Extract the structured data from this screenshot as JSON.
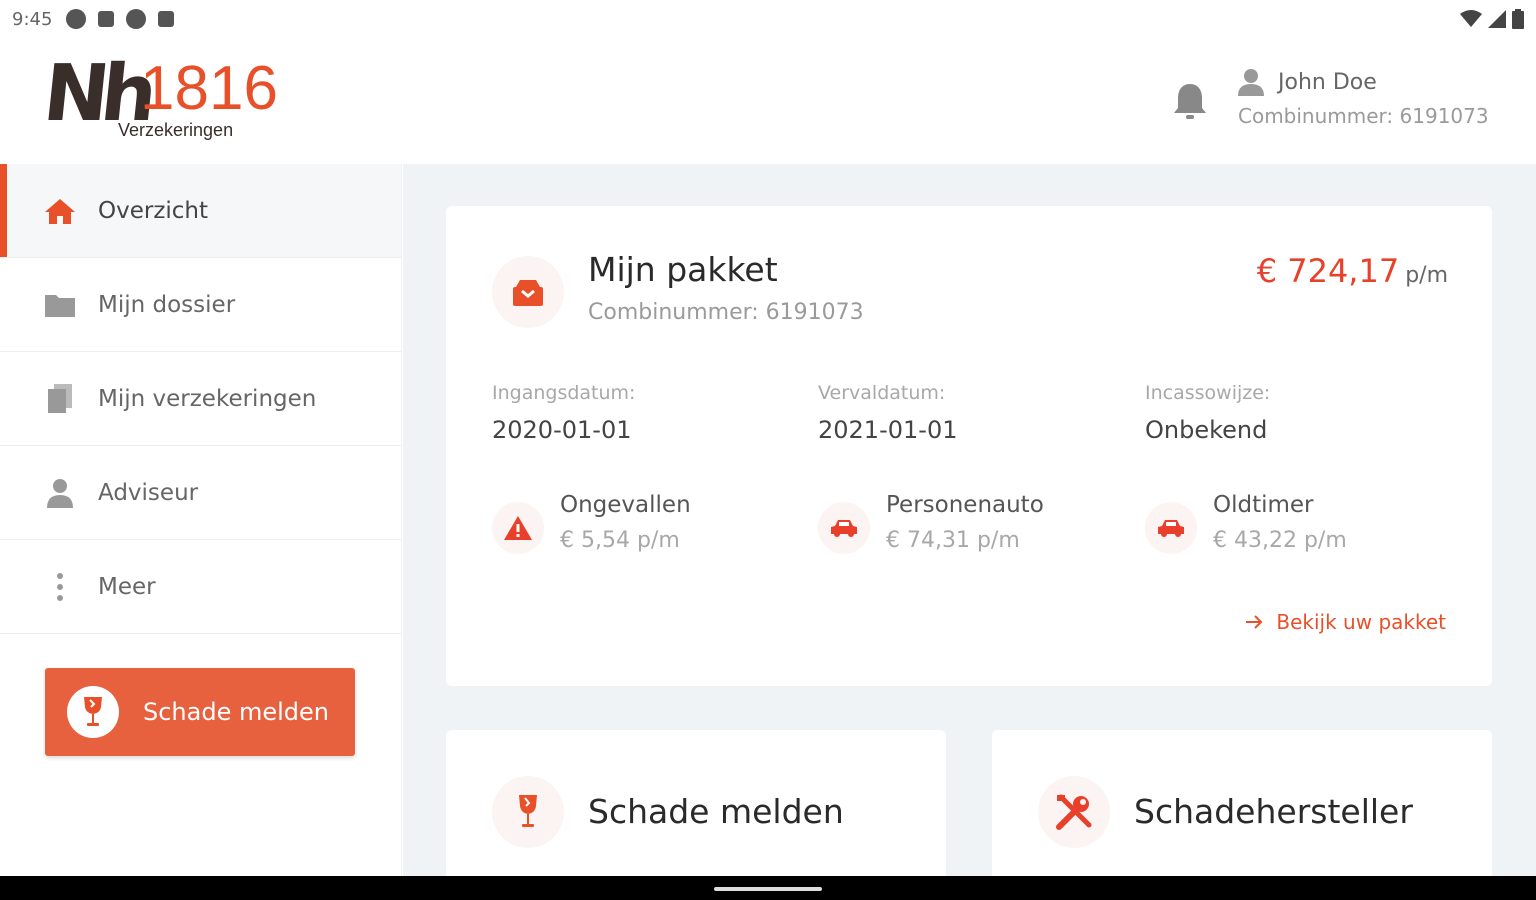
{
  "status_bar": {
    "time": "9:45"
  },
  "brand": {
    "logo_mark": "Nh",
    "logo_number": "1816",
    "logo_sub": "Verzekeringen"
  },
  "header": {
    "user_name": "John Doe",
    "user_combi": "Combinummer: 6191073"
  },
  "sidebar": {
    "items": [
      {
        "label": "Overzicht",
        "icon": "home-icon",
        "active": true
      },
      {
        "label": "Mijn dossier",
        "icon": "folder-icon"
      },
      {
        "label": "Mijn verzekeringen",
        "icon": "documents-icon"
      },
      {
        "label": "Adviseur",
        "icon": "person-icon"
      },
      {
        "label": "Meer",
        "icon": "more-vertical-icon"
      }
    ],
    "cta_label": "Schade melden"
  },
  "package": {
    "title": "Mijn pakket",
    "subtitle": "Combinummer: 6191073",
    "price": "€ 724,17",
    "price_unit": "p/m",
    "fields": [
      {
        "label": "Ingangsdatum:",
        "value": "2020-01-01"
      },
      {
        "label": "Vervaldatum:",
        "value": "2021-01-01"
      },
      {
        "label": "Incassowijze:",
        "value": "Onbekend"
      }
    ],
    "coverages": [
      {
        "name": "Ongevallen",
        "price": "€ 5,54 p/m",
        "icon": "warning-icon"
      },
      {
        "name": "Personenauto",
        "price": "€ 74,31 p/m",
        "icon": "car-icon"
      },
      {
        "name": "Oldtimer",
        "price": "€ 43,22 p/m",
        "icon": "car-icon"
      }
    ],
    "link_label": "Bekijk uw pakket"
  },
  "quick_cards": [
    {
      "title": "Schade melden",
      "icon": "broken-glass-icon"
    },
    {
      "title": "Schadehersteller",
      "icon": "tools-icon"
    }
  ],
  "colors": {
    "accent": "#e8502a",
    "cta": "#e8613f",
    "price": "#e8402a",
    "background": "#f0f3f5"
  }
}
